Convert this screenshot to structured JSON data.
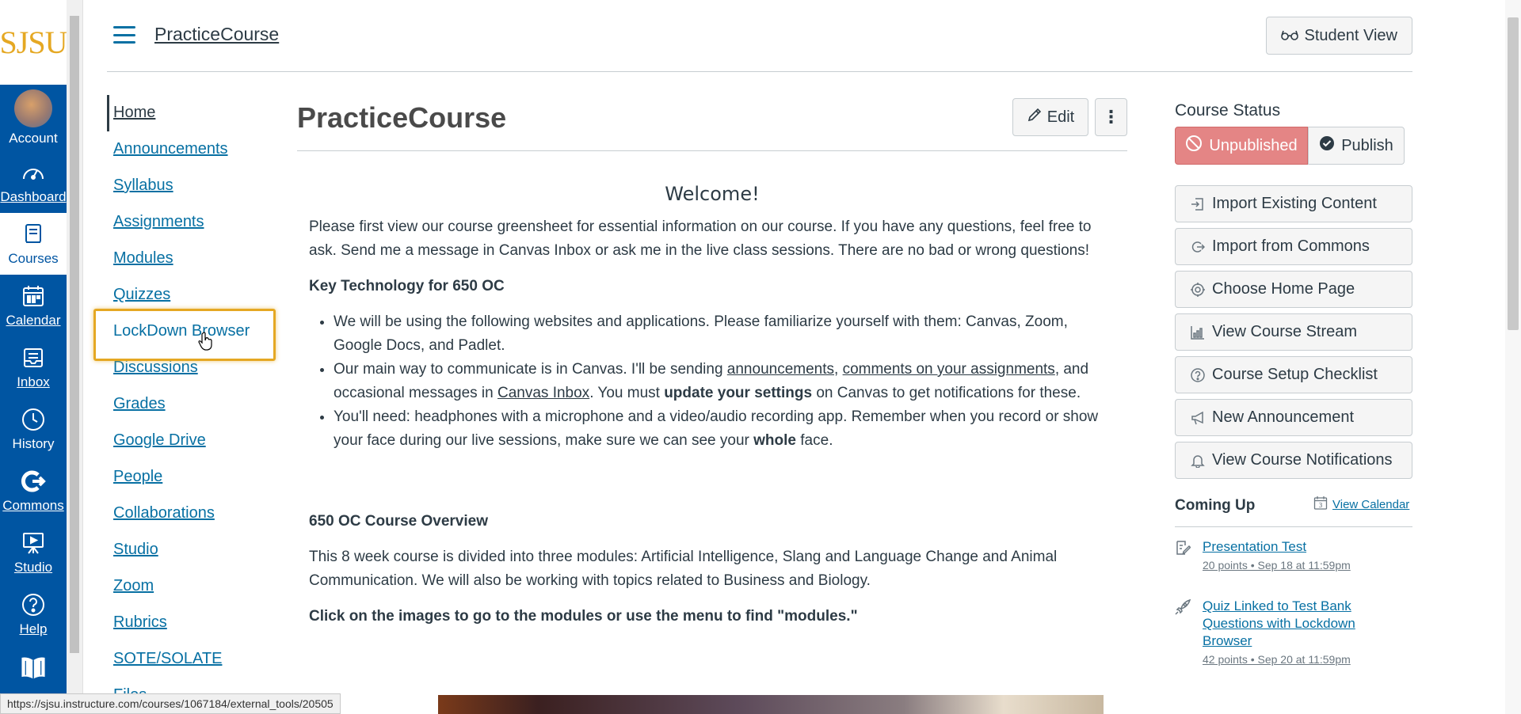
{
  "global_nav": {
    "logo": "SJSU",
    "items": [
      {
        "label": "Account",
        "icon": "avatar"
      },
      {
        "label": "Dashboard",
        "icon": "dashboard-icon"
      },
      {
        "label": "Courses",
        "icon": "courses-icon"
      },
      {
        "label": "Calendar",
        "icon": "calendar-icon"
      },
      {
        "label": "Inbox",
        "icon": "inbox-icon"
      },
      {
        "label": "History",
        "icon": "history-icon"
      },
      {
        "label": "Commons",
        "icon": "commons-icon"
      },
      {
        "label": "Studio",
        "icon": "studio-icon"
      },
      {
        "label": "Help",
        "icon": "help-icon"
      }
    ]
  },
  "header": {
    "breadcrumb": "PracticeCourse",
    "student_view": "Student View"
  },
  "course_nav": {
    "items": [
      "Home",
      "Announcements",
      "Syllabus",
      "Assignments",
      "Modules",
      "Quizzes",
      "LockDown Browser",
      "Discussions",
      "Grades",
      "Google Drive",
      "People",
      "Collaborations",
      "Studio",
      "Zoom",
      "Rubrics",
      "SOTE/SOLATE",
      "Files"
    ]
  },
  "main": {
    "title": "PracticeCourse",
    "edit_label": "Edit",
    "more_label": "⋮",
    "welcome": "Welcome!",
    "intro": "Please first view our course greensheet for essential information on our course. If you have any questions, feel free to ask. Send me a message in Canvas Inbox or ask me in the live class sessions. There are no bad or wrong questions!",
    "key_tech_heading": "Key Technology for 650 OC",
    "bullet1": "We will be using the following websites and applications. Please familiarize yourself with them: Canvas, Zoom, Google Docs, and Padlet.",
    "bullet2_a": "Our main way to communicate is in Canvas. I'll be sending ",
    "bullet2_link1": "announcements",
    "bullet2_b": ", ",
    "bullet2_link2": "comments on your assignments",
    "bullet2_c": ", and occasional messages in ",
    "bullet2_link3": "Canvas Inbox",
    "bullet2_d": ". You must ",
    "bullet2_bold": "update your settings",
    "bullet2_e": " on Canvas to get notifications for these.",
    "bullet3_a": "You'll need: headphones with a microphone and a video/audio recording app. Remember when you record or show your face during our live sessions, make sure we can see your ",
    "bullet3_bold": "whole",
    "bullet3_b": " face.",
    "overview_heading": "650 OC Course Overview",
    "overview": "This 8 week course is divided into three modules: Artificial Intelligence, Slang and Language Change and Animal Communication. We will also be working with topics related to Business and Biology.",
    "click_note": "Click on the images to go to the modules or use the menu to find \"modules.\""
  },
  "sidebar": {
    "status_heading": "Course Status",
    "unpublished": "Unpublished",
    "publish": "Publish",
    "buttons": [
      "Import Existing Content",
      "Import from Commons",
      "Choose Home Page",
      "View Course Stream",
      "Course Setup Checklist",
      "New Announcement",
      "View Course Notifications"
    ],
    "coming_up": "Coming Up",
    "view_calendar": "View Calendar",
    "calendar_day": "3",
    "events": [
      {
        "title": "Presentation Test",
        "meta": "20 points • Sep 18 at 11:59pm"
      },
      {
        "title": "Quiz Linked to Test Bank Questions with Lockdown Browser",
        "meta": "42 points • Sep 20 at 11:59pm"
      }
    ]
  },
  "status_bar": {
    "url": "https://sjsu.instructure.com/courses/1067184/external_tools/20505"
  },
  "colors": {
    "nav_blue": "#0055a2",
    "logo_gold": "#e5a823",
    "link": "#0770a3",
    "unpublished": "#e48585"
  }
}
